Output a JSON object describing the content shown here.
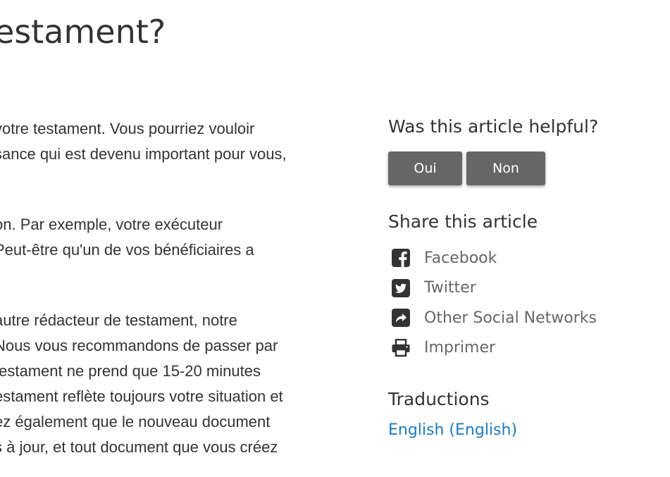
{
  "article": {
    "title": "estament?",
    "paragraphs": [
      [
        "votre testament. Vous pourriez vouloir",
        "sance qui est devenu important pour vous,"
      ],
      [
        "on. Par exemple, votre exécuteur",
        "Peut-être qu'un de vos bénéficiaires a"
      ],
      [
        "autre rédacteur de testament, notre",
        "Nous vous recommandons de passer par",
        "testament ne prend que 15-20 minutes",
        "estament reflète toujours votre situation et",
        "ez également que le nouveau document",
        "s à jour, et tout document que vous créez"
      ]
    ]
  },
  "sidebar": {
    "helpful_title": "Was this article helpful?",
    "yes_label": "Oui",
    "no_label": "Non",
    "share_title": "Share this article",
    "share_items": [
      {
        "label": "Facebook",
        "icon": "facebook-icon"
      },
      {
        "label": "Twitter",
        "icon": "twitter-icon"
      },
      {
        "label": "Other Social Networks",
        "icon": "share-icon"
      },
      {
        "label": "Imprimer",
        "icon": "print-icon"
      }
    ],
    "translations_title": "Traductions",
    "translations": [
      {
        "label": "English (English)"
      }
    ]
  },
  "colors": {
    "text": "#333333",
    "muted": "#666666",
    "button_bg": "#666666",
    "button_text": "#ffffff",
    "link": "#1f7bbf"
  }
}
